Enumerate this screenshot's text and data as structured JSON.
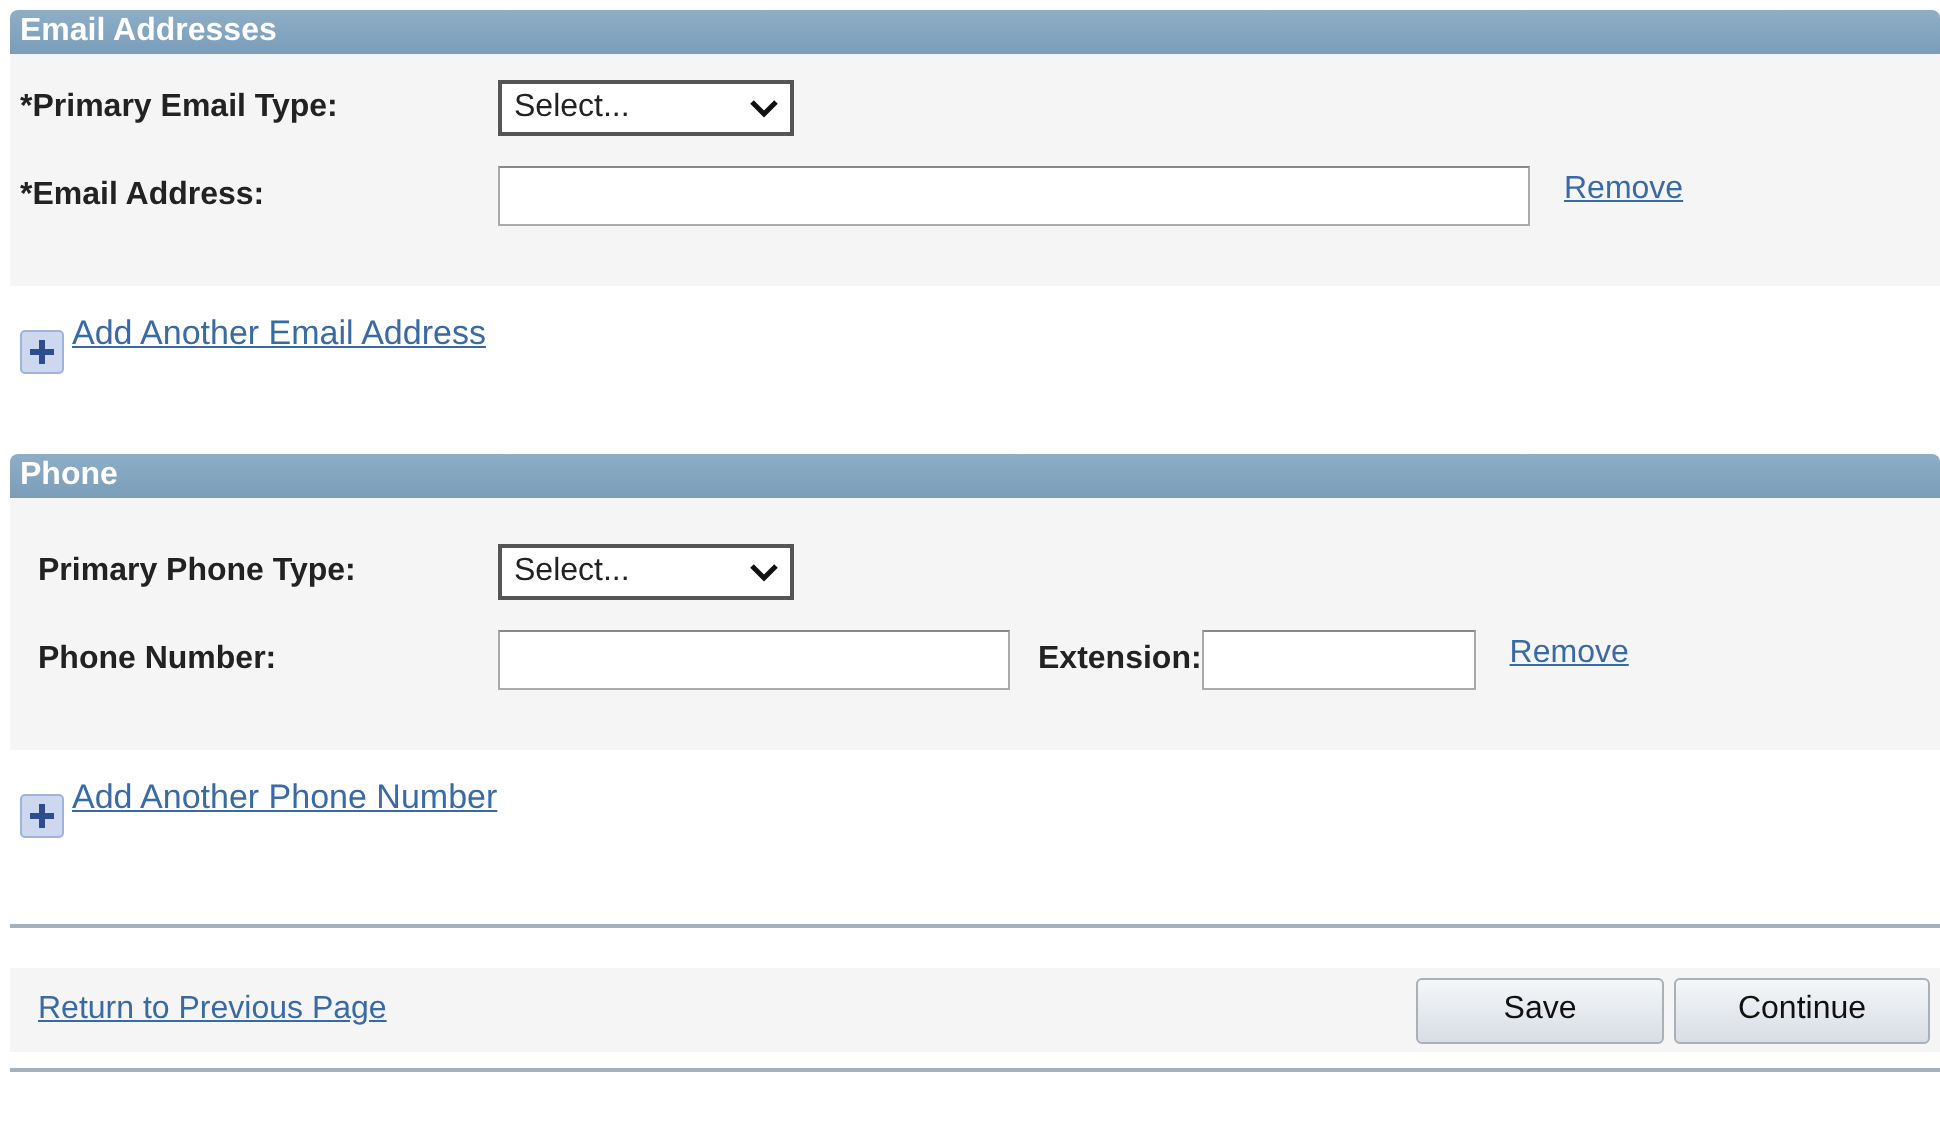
{
  "sections": [
    {
      "title": "Email Addresses",
      "rows": [
        {
          "label": "*Primary Email Type:",
          "items": [
            {
              "kind": "select",
              "value": "Select..."
            }
          ]
        },
        {
          "label": "*Email Address:",
          "items": [
            {
              "kind": "long_input"
            },
            {
              "kind": "link",
              "text": "Remove"
            }
          ]
        }
      ],
      "add_link": "Add Another Email Address"
    },
    {
      "title": "Phone",
      "rows": [
        {
          "label": "Primary Phone Type:",
          "items": [
            {
              "kind": "select",
              "value": "Select..."
            }
          ]
        },
        {
          "label": "Phone Number:",
          "items": [
            {
              "kind": "medium_input"
            },
            {
              "kind": "label",
              "text": "Extension:"
            },
            {
              "kind": "short_input"
            },
            {
              "kind": "link",
              "text": "Remove"
            }
          ]
        }
      ],
      "add_link": "Add Another Phone Number"
    }
  ],
  "footer": {
    "link": "Return to Previous Page",
    "buttons": [
      "Save",
      "Continue"
    ]
  }
}
